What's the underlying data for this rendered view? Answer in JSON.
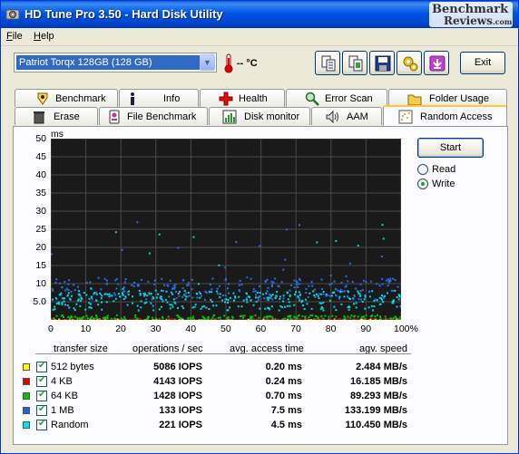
{
  "window": {
    "title": "HD Tune Pro 3.50 - Hard Disk Utility",
    "brand_line1": "Benchmark",
    "brand_line2": "Reviews",
    "brand_suffix": ".com"
  },
  "menu": [
    {
      "label": "File",
      "hotkey": "F"
    },
    {
      "label": "Help",
      "hotkey": "H"
    }
  ],
  "toolbar": {
    "drive": "Patriot Torqx 128GB (128 GB)",
    "temperature": "-- °C",
    "exit_label": "Exit",
    "buttons": [
      "copy-text-icon",
      "copy-screenshot-icon",
      "save-icon",
      "options-icon",
      "minimize-to-tray-icon"
    ]
  },
  "tabs_top": [
    {
      "label": "Benchmark",
      "icon": "benchmark-icon"
    },
    {
      "label": "Info",
      "icon": "info-icon"
    },
    {
      "label": "Health",
      "icon": "health-icon"
    },
    {
      "label": "Error Scan",
      "icon": "error-scan-icon"
    },
    {
      "label": "Folder Usage",
      "icon": "folder-icon"
    }
  ],
  "tabs_bottom": [
    {
      "label": "Erase",
      "icon": "trash-icon"
    },
    {
      "label": "File Benchmark",
      "icon": "file-benchmark-icon"
    },
    {
      "label": "Disk monitor",
      "icon": "disk-monitor-icon"
    },
    {
      "label": "AAM",
      "icon": "speaker-icon"
    },
    {
      "label": "Random Access",
      "icon": "random-access-icon",
      "active": true
    }
  ],
  "controls": {
    "start_label": "Start",
    "mode_options": [
      "Read",
      "Write"
    ],
    "mode_selected": "Write"
  },
  "chart_data": {
    "type": "scatter",
    "title": "",
    "ylabel": "ms",
    "xlabel": "",
    "ylim": [
      0,
      50
    ],
    "xlim": [
      0,
      100
    ],
    "y_ticks": [
      "50",
      "45",
      "40",
      "35",
      "30",
      "25",
      "20",
      "15",
      "10",
      "5.0"
    ],
    "x_ticks": [
      "0",
      "10",
      "20",
      "30",
      "40",
      "50",
      "60",
      "70",
      "80",
      "90",
      "100%"
    ],
    "grid": true,
    "series": [
      {
        "name": "512 bytes",
        "color": "#e8e800",
        "typical_ms": 0.2
      },
      {
        "name": "4 KB",
        "color": "#e00000",
        "typical_ms": 0.24
      },
      {
        "name": "64 KB",
        "color": "#00c800",
        "typical_ms": 0.7
      },
      {
        "name": "1 MB",
        "color": "#2a6ef0",
        "typical_ms": 7.5
      },
      {
        "name": "Random",
        "color": "#00d8e8",
        "typical_ms": 4.5
      }
    ]
  },
  "table": {
    "headers": [
      "transfer size",
      "operations / sec",
      "avg. access time",
      "agv. speed"
    ],
    "rows": [
      {
        "size": "512 bytes",
        "color": "#ffff00",
        "checked": true,
        "ops": "5086 IOPS",
        "access": "0.20 ms",
        "speed": "2.484 MB/s"
      },
      {
        "size": "4 KB",
        "color": "#e00000",
        "checked": true,
        "ops": "4143 IOPS",
        "access": "0.24 ms",
        "speed": "16.185 MB/s"
      },
      {
        "size": "64 KB",
        "color": "#00c800",
        "checked": true,
        "ops": "1428 IOPS",
        "access": "0.70 ms",
        "speed": "89.293 MB/s"
      },
      {
        "size": "1 MB",
        "color": "#1f5fe0",
        "checked": true,
        "ops": "133 IOPS",
        "access": "7.5 ms",
        "speed": "133.199 MB/s"
      },
      {
        "size": "Random",
        "color": "#00e0f0",
        "checked": true,
        "ops": "221 IOPS",
        "access": "4.5 ms",
        "speed": "110.450 MB/s"
      }
    ]
  }
}
